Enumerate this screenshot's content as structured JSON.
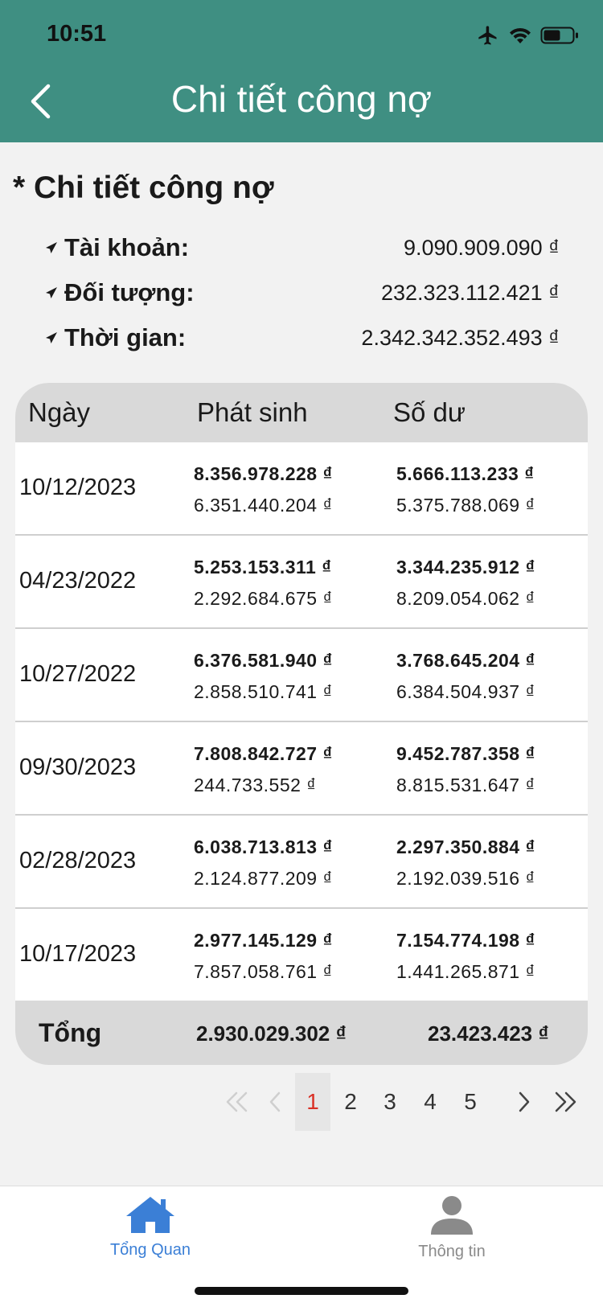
{
  "status_bar": {
    "time": "10:51"
  },
  "header": {
    "title": "Chi tiết công nợ"
  },
  "summary": {
    "title": "* Chi tiết công nợ",
    "rows": [
      {
        "label": "Tài khoản:",
        "value": "9.090.909.090 ₫"
      },
      {
        "label": "Đối tượng:",
        "value": "232.323.112.421 ₫"
      },
      {
        "label": "Thời gian:",
        "value": "2.342.342.352.493 ₫"
      }
    ]
  },
  "table": {
    "headers": [
      "Ngày",
      "Phát sinh",
      "Số dư"
    ],
    "rows": [
      {
        "date": "10/12/2023",
        "phat_sinh": "8.356.978.228 ₫",
        "phat_sinh_sub": "6.351.440.204 ₫",
        "so_du": "5.666.113.233 ₫",
        "so_du_sub": "5.375.788.069 ₫"
      },
      {
        "date": "04/23/2022",
        "phat_sinh": "5.253.153.311 ₫",
        "phat_sinh_sub": "2.292.684.675 ₫",
        "so_du": "3.344.235.912 ₫",
        "so_du_sub": "8.209.054.062 ₫"
      },
      {
        "date": "10/27/2022",
        "phat_sinh": "6.376.581.940 ₫",
        "phat_sinh_sub": "2.858.510.741 ₫",
        "so_du": "3.768.645.204 ₫",
        "so_du_sub": "6.384.504.937 ₫"
      },
      {
        "date": "09/30/2023",
        "phat_sinh": "7.808.842.727 ₫",
        "phat_sinh_sub": "244.733.552 ₫",
        "so_du": "9.452.787.358 ₫",
        "so_du_sub": "8.815.531.647 ₫"
      },
      {
        "date": "02/28/2023",
        "phat_sinh": "6.038.713.813 ₫",
        "phat_sinh_sub": "2.124.877.209 ₫",
        "so_du": "2.297.350.884 ₫",
        "so_du_sub": "2.192.039.516 ₫"
      },
      {
        "date": "10/17/2023",
        "phat_sinh": "2.977.145.129 ₫",
        "phat_sinh_sub": "7.857.058.761 ₫",
        "so_du": "7.154.774.198 ₫",
        "so_du_sub": "1.441.265.871 ₫"
      }
    ],
    "footer": {
      "label": "Tổng",
      "phat_sinh": "2.930.029.302 ₫",
      "so_du": "23.423.423 ₫"
    }
  },
  "pagination": {
    "first": "«",
    "prev": "‹",
    "next": "›",
    "last": "»",
    "pages": [
      "1",
      "2",
      "3",
      "4",
      "5"
    ],
    "current": "1"
  },
  "tabbar": {
    "items": [
      {
        "label": "Tổng Quan",
        "active": true
      },
      {
        "label": "Thông tin",
        "active": false
      }
    ],
    "active_color": "#3b7fd6",
    "inactive_color": "#8a8a8a"
  },
  "colors": {
    "header_bg": "#3f8f82",
    "page_bg": "#f2f2f2",
    "table_header_bg": "#d9d9d9",
    "active_page": "#d93025"
  }
}
